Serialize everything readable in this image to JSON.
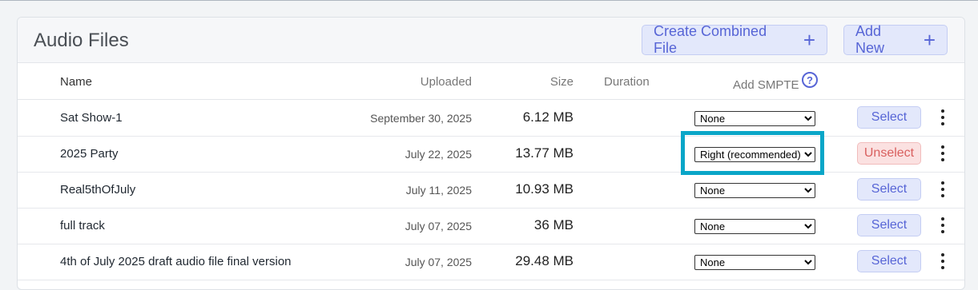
{
  "card": {
    "title": "Audio Files",
    "create_combined_label": "Create Combined File",
    "add_new_label": "Add New",
    "plus_glyph": "+"
  },
  "columns": {
    "name": "Name",
    "uploaded": "Uploaded",
    "size": "Size",
    "duration": "Duration",
    "smpte": "Add SMPTE",
    "help_glyph": "?"
  },
  "rows": [
    {
      "name": "Sat Show-1",
      "uploaded": "September 30, 2025",
      "size": "6.12 MB",
      "smpte": "None",
      "action": "Select"
    },
    {
      "name": "2025 Party",
      "uploaded": "July 22, 2025",
      "size": "13.77 MB",
      "smpte": "Right (recommended)",
      "action": "Unselect"
    },
    {
      "name": "Real5thOfJuly",
      "uploaded": "July 11, 2025",
      "size": "10.93 MB",
      "smpte": "None",
      "action": "Select"
    },
    {
      "name": "full track",
      "uploaded": "July 07, 2025",
      "size": "36 MB",
      "smpte": "None",
      "action": "Select"
    },
    {
      "name": "4th of July 2025 draft audio file final version",
      "uploaded": "July 07, 2025",
      "size": "29.48 MB",
      "smpte": "None",
      "action": "Select"
    }
  ],
  "colors": {
    "accent": "#5765d6",
    "highlight": "#0aa6c8",
    "unselect": "#d9605f"
  }
}
